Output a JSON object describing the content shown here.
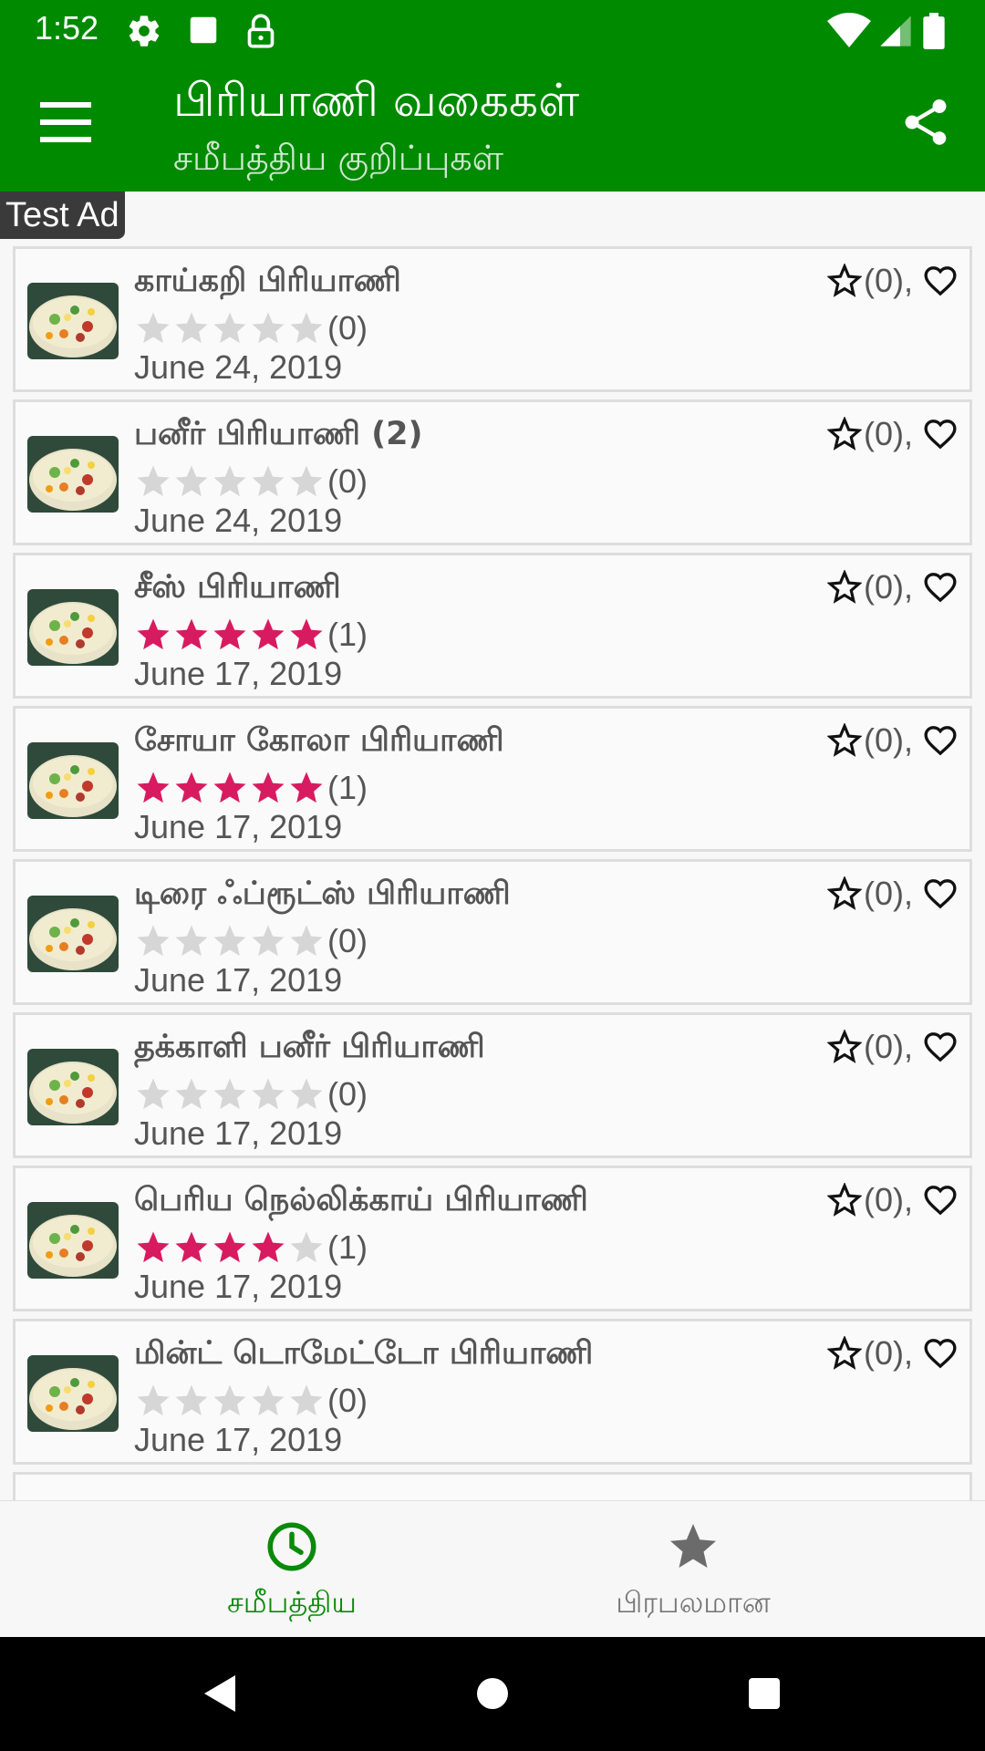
{
  "status_bar": {
    "time": "1:52"
  },
  "app_bar": {
    "title": "பிரியாணி வகைகள்",
    "subtitle": "சமீபத்திய குறிப்புகள்"
  },
  "ad": {
    "label": "Test Ad"
  },
  "colors": {
    "primary": "#008a00",
    "star_filled": "#d81b60",
    "star_empty": "#d6d6d6"
  },
  "recipes": [
    {
      "title": "காய்கறி பிரியாணி",
      "rating": 0,
      "rating_count": "(0)",
      "date": "June 24, 2019",
      "fav_count": "(0),"
    },
    {
      "title": "பனீர் பிரியாணி (2)",
      "rating": 0,
      "rating_count": "(0)",
      "date": "June 24, 2019",
      "fav_count": "(0),"
    },
    {
      "title": "சீஸ் பிரியாணி",
      "rating": 5,
      "rating_count": "(1)",
      "date": "June 17, 2019",
      "fav_count": "(0),"
    },
    {
      "title": "சோயா கோலா பிரியாணி",
      "rating": 5,
      "rating_count": "(1)",
      "date": "June 17, 2019",
      "fav_count": "(0),"
    },
    {
      "title": "டிரை ஃப்ரூட்ஸ் பிரியாணி",
      "rating": 0,
      "rating_count": "(0)",
      "date": "June 17, 2019",
      "fav_count": "(0),"
    },
    {
      "title": "தக்காளி பனீர் பிரியாணி",
      "rating": 0,
      "rating_count": "(0)",
      "date": "June 17, 2019",
      "fav_count": "(0),"
    },
    {
      "title": "பெரிய நெல்லிக்காய் பிரியாணி",
      "rating": 4,
      "rating_count": "(1)",
      "date": "June 17, 2019",
      "fav_count": "(0),"
    },
    {
      "title": "மின்ட் டொமேட்டோ பிரியாணி",
      "rating": 0,
      "rating_count": "(0)",
      "date": "June 17, 2019",
      "fav_count": "(0),"
    }
  ],
  "bottom_nav": {
    "items": [
      {
        "label": "சமீபத்திய",
        "icon": "clock-icon",
        "active": true
      },
      {
        "label": "பிரபலமான",
        "icon": "star-icon",
        "active": false
      }
    ]
  }
}
